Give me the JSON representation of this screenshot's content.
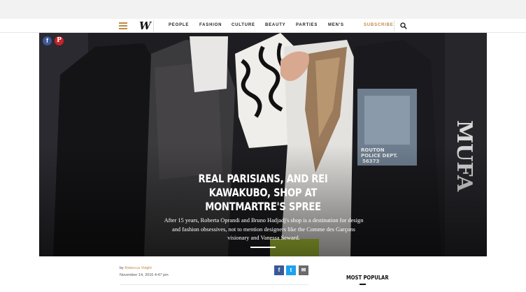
{
  "nav": {
    "menu_icon": "hamburger-menu-icon",
    "logo": "W",
    "items": [
      "PEOPLE",
      "FASHION",
      "CULTURE",
      "BEAUTY",
      "PARTIES",
      "MEN'S"
    ],
    "subscribe": "SUBSCRIBE",
    "search_icon": "search-icon"
  },
  "colors": {
    "accent": "#c08a45",
    "facebook": "#3b5998",
    "pinterest": "#cb2027",
    "twitter": "#1da1f2",
    "email": "#6a6a6a"
  },
  "hero": {
    "share": {
      "facebook": "f",
      "pinterest": "P"
    },
    "title": "REAL PARISIANS, AND REI KAWAKUBO, SHOP AT MONTMARTRE'S SPREE",
    "dek": "After 15 years, Roberta Oprandi and Bruno Hadjadj's shop is a destination for design and fashion obsessives, not to mention designers like the Comme des Garçons visionary and Vanessa Seward.",
    "photo_text": {
      "sweatshirt": "ROUTON POLICE DEPT. 56373",
      "sleeve": "MUFA"
    }
  },
  "article": {
    "by_prefix": "by",
    "author": "Rebecca Voight",
    "date": "November 14, 2016 4:47 pm",
    "share_buttons": {
      "facebook": "f",
      "twitter": "t",
      "email": "✉"
    }
  },
  "sidebar": {
    "most_popular": "MOST POPULAR"
  }
}
